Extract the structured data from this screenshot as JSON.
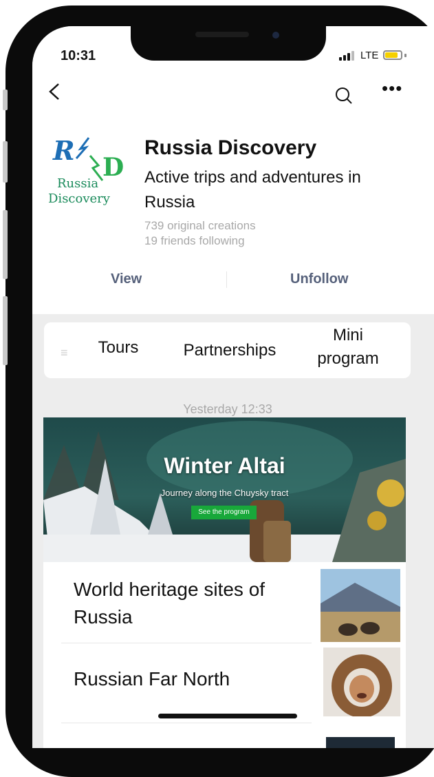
{
  "status_bar": {
    "time": "10:31",
    "network": "LTE"
  },
  "nav": {
    "back_icon": "chevron-left-icon",
    "search_icon": "search-icon",
    "more_icon": "more-icon"
  },
  "profile": {
    "logo_text_line1": "Russia",
    "logo_text_line2": "Discovery",
    "name": "Russia Discovery",
    "description": "Active trips and adventures in Russia",
    "stats": {
      "creations": "739 original creations",
      "friends": "19 friends following"
    },
    "actions": {
      "view": "View",
      "unfollow": "Unfollow"
    }
  },
  "menu": {
    "items": [
      "Tours",
      "Partnerships",
      "Mini program"
    ]
  },
  "feed": {
    "timestamp": "Yesterday 12:33",
    "hero": {
      "title": "Winter Altai",
      "subtitle": "Journey along the Chuysky tract",
      "button": "See the program"
    },
    "articles": [
      {
        "title": "World heritage sites of Russia"
      },
      {
        "title": "Russian Far North"
      }
    ]
  },
  "colors": {
    "accent_link": "#55607a",
    "button_green": "#18a83a",
    "logo_blue": "#1d6eb5",
    "logo_green": "#198a5a"
  }
}
